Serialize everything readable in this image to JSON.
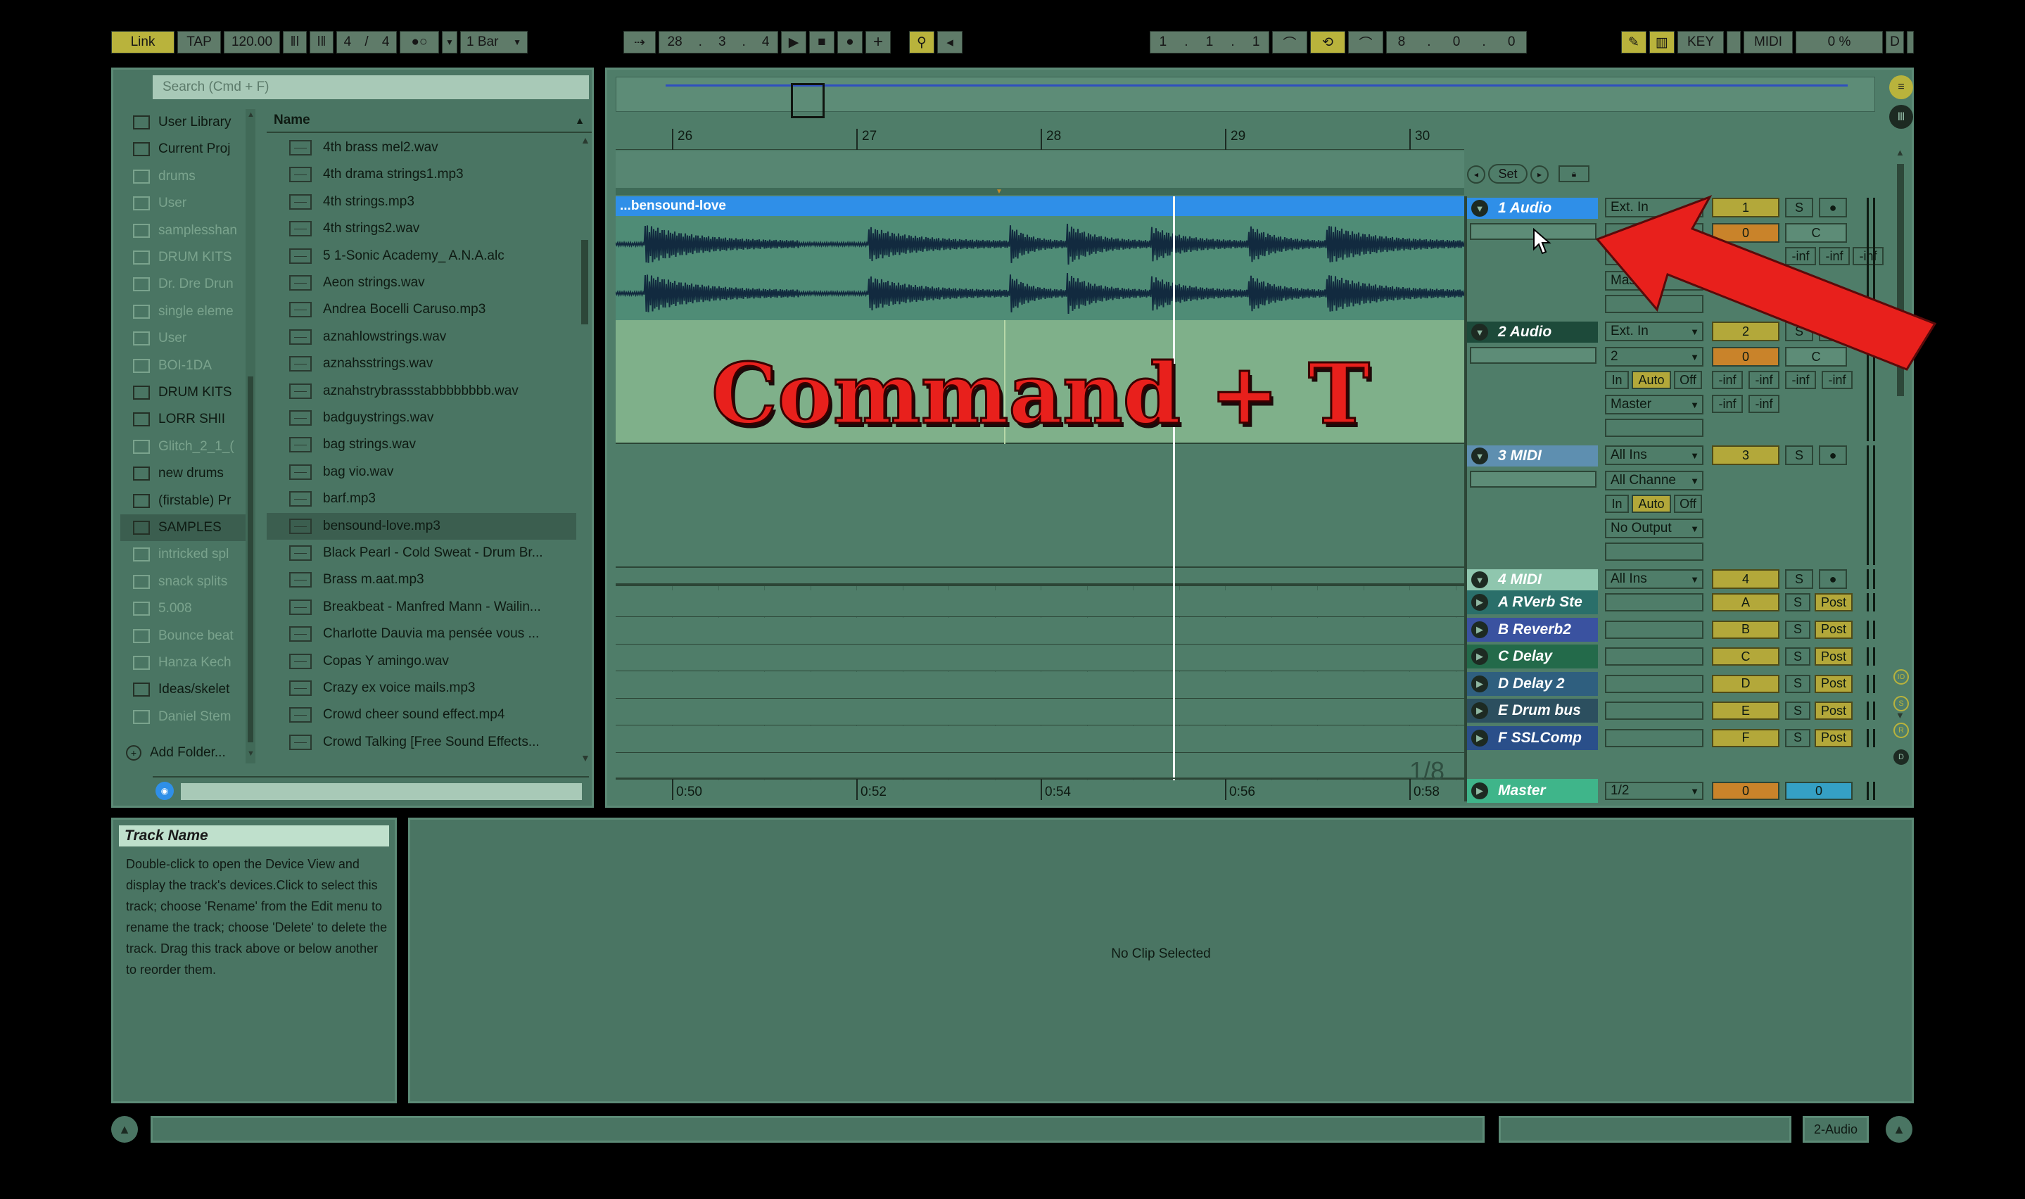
{
  "transport": {
    "link": "Link",
    "tap": "TAP",
    "tempo": "120.00",
    "sig_num": "4",
    "sig_den": "4",
    "quant": "1 Bar",
    "pos_bar": "28",
    "pos_beat": "3",
    "pos_sixteenth": "4",
    "loop_start_bar": "1",
    "loop_start_beat": "1",
    "loop_start_sixteenth": "1",
    "loop_len_bar": "8",
    "loop_len_beat": "0",
    "loop_len_sixteenth": "0",
    "key": "KEY",
    "midi": "MIDI",
    "cpu": "0 %",
    "d": "D"
  },
  "browser": {
    "search_placeholder": "Search (Cmd + F)",
    "places": [
      {
        "label": "User Library",
        "faded": false
      },
      {
        "label": "Current Proj",
        "faded": false
      },
      {
        "label": "drums",
        "faded": true
      },
      {
        "label": "User",
        "faded": true
      },
      {
        "label": "samplesshan",
        "faded": true
      },
      {
        "label": "DRUM KITS",
        "faded": true
      },
      {
        "label": "Dr. Dre Drun",
        "faded": true
      },
      {
        "label": "single eleme",
        "faded": true
      },
      {
        "label": "User",
        "faded": true
      },
      {
        "label": "BOI-1DA",
        "faded": true
      },
      {
        "label": "DRUM KITS",
        "faded": false
      },
      {
        "label": "LORR SHII",
        "faded": false
      },
      {
        "label": "Glitch_2_1_(",
        "faded": true
      },
      {
        "label": "new drums",
        "faded": false
      },
      {
        "label": "(firstable) Pr",
        "faded": false
      },
      {
        "label": "SAMPLES",
        "faded": false,
        "selected": true
      },
      {
        "label": "intricked spl",
        "faded": true
      },
      {
        "label": "snack splits",
        "faded": true
      },
      {
        "label": "5.008",
        "faded": true
      },
      {
        "label": "Bounce beat",
        "faded": true
      },
      {
        "label": "Hanza Kech",
        "faded": true
      },
      {
        "label": "Ideas/skelet",
        "faded": false
      },
      {
        "label": "Daniel Stem",
        "faded": true
      }
    ],
    "add_folder": "Add Folder...",
    "column_name": "Name",
    "files": [
      "4th brass mel2.wav",
      "4th drama strings1.mp3",
      "4th strings.mp3",
      "4th strings2.wav",
      "5 1-Sonic Academy_ A.N.A.alc",
      "Aeon strings.wav",
      "Andrea Bocelli Caruso.mp3",
      "aznahlowstrings.wav",
      "aznahsstrings.wav",
      "aznahstrybrassstabbbbbbbb.wav",
      "badguystrings.wav",
      "bag strings.wav",
      "bag vio.wav",
      "barf.mp3",
      "bensound-love.mp3",
      "Black Pearl - Cold Sweat - Drum Br...",
      "Brass m.aat.mp3",
      "Breakbeat - Manfred Mann - Wailin...",
      "Charlotte Dauvia  ma pensée vous ...",
      "Copas Y amingo.wav",
      "Crazy ex voice mails.mp3",
      "Crowd cheer sound effect.mp4",
      "Crowd Talking [Free Sound Effects..."
    ],
    "selected_file_index": 14
  },
  "arrangement": {
    "bar_labels": [
      "26",
      "27",
      "28",
      "29",
      "30"
    ],
    "time_labels": [
      "0:50",
      "0:52",
      "0:54",
      "0:56",
      "0:58"
    ],
    "clip_name": "...bensound-love",
    "zoom": "1/8",
    "set_label": "Set",
    "overlay_text": "Command + T"
  },
  "tracks": [
    {
      "name": "1 Audio",
      "number": "1",
      "volume": "0",
      "pan": "C",
      "color": "#2f8fe8",
      "input": "Ext. In",
      "channel": "",
      "output": "Master",
      "type": "audio"
    },
    {
      "name": "2 Audio",
      "number": "2",
      "volume": "0",
      "pan": "C",
      "color": "#1d4a3a",
      "input": "Ext. In",
      "channel": "2",
      "output": "Master",
      "type": "audio"
    },
    {
      "name": "3 MIDI",
      "number": "3",
      "color": "#5e8fb0",
      "input": "All Ins",
      "channel": "All Channe",
      "output": "No Output",
      "type": "midi"
    },
    {
      "name": "4 MIDI",
      "number": "4",
      "color": "#8fc6ae",
      "input": "All Ins",
      "type": "midi"
    }
  ],
  "monitor": {
    "in": "In",
    "auto": "Auto",
    "off": "Off"
  },
  "meters": {
    "inf": "-inf"
  },
  "returns": [
    {
      "name": "A RVerb Ste",
      "letter": "A",
      "color": "#2a6f6a"
    },
    {
      "name": "B Reverb2",
      "letter": "B",
      "color": "#3a52a0"
    },
    {
      "name": "C Delay",
      "letter": "C",
      "color": "#236a4a"
    },
    {
      "name": "D Delay 2",
      "letter": "D",
      "color": "#2f5f7f"
    },
    {
      "name": "E Drum bus",
      "letter": "E",
      "color": "#2c4f5f"
    },
    {
      "name": "F SSLComp",
      "letter": "F",
      "color": "#2a4f8a"
    }
  ],
  "master": {
    "name": "Master",
    "color": "#3fb58a",
    "cue": "1/2",
    "volume": "0",
    "pan": "0"
  },
  "solo": "S",
  "post": "Post",
  "info": {
    "title": "Track Name",
    "body": "Double-click to open the Device View and display the track's devices.Click to select this track; choose 'Rename' from the Edit menu to rename the track; choose 'Delete' to delete the track. Drag this track above or below another to reorder them."
  },
  "detail": {
    "no_clip": "No Clip Selected"
  },
  "status": {
    "selected_track": "2-Audio"
  },
  "colors": {
    "bg": "#000000",
    "panel": "#4a7563",
    "accent_yellow": "#b9b33c",
    "clip_blue": "#2f8fe8",
    "overlay_red": "#e8201c"
  }
}
